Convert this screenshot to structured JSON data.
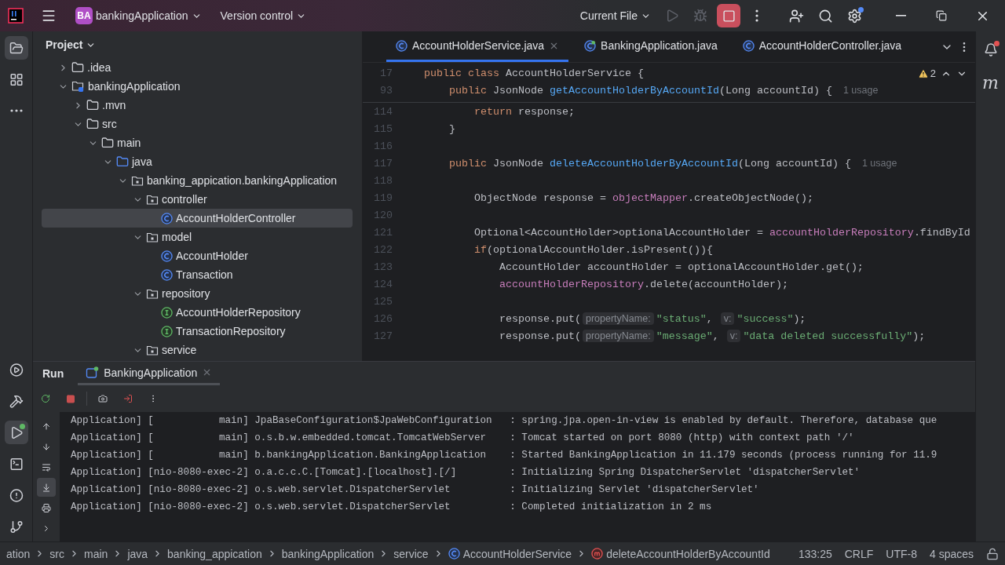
{
  "title_bar": {
    "project_badge": "BA",
    "project_name": "bankingApplication",
    "vcs_widget": "Version control",
    "run_config": "Current File",
    "run_enabled": false,
    "debug_enabled": false,
    "stop_enabled": true,
    "settings_update": true
  },
  "left_stripe": {
    "top": [
      {
        "kind": "project",
        "selected": true
      },
      {
        "kind": "structure",
        "selected": false
      },
      {
        "kind": "more",
        "selected": false
      }
    ],
    "bottom": [
      {
        "kind": "services",
        "selected": false,
        "running": false
      },
      {
        "kind": "build",
        "selected": false,
        "running": false
      },
      {
        "kind": "run",
        "selected": true,
        "running": true
      },
      {
        "kind": "terminal",
        "selected": false,
        "running": false
      },
      {
        "kind": "problems",
        "selected": false,
        "running": false
      },
      {
        "kind": "git",
        "selected": false,
        "running": false
      }
    ]
  },
  "project": {
    "title": "Project",
    "tree": [
      {
        "label": ".idea",
        "kind": "folder",
        "expanded": false,
        "selected": false
      },
      {
        "label": "bankingApplication",
        "kind": "module",
        "expanded": true,
        "selected": false,
        "children": [
          {
            "label": ".mvn",
            "kind": "folder",
            "expanded": false,
            "selected": false
          },
          {
            "label": "src",
            "kind": "folder",
            "expanded": true,
            "selected": false,
            "children": [
              {
                "label": "main",
                "kind": "folder",
                "expanded": true,
                "selected": false,
                "children": [
                  {
                    "label": "java",
                    "kind": "source",
                    "expanded": true,
                    "selected": false,
                    "children": [
                      {
                        "label": "banking_appication.bankingApplication",
                        "kind": "package",
                        "expanded": true,
                        "selected": false,
                        "children": [
                          {
                            "label": "controller",
                            "kind": "package",
                            "expanded": true,
                            "selected": false,
                            "children": [
                              {
                                "label": "AccountHolderController",
                                "kind": "class",
                                "selected": true
                              }
                            ]
                          },
                          {
                            "label": "model",
                            "kind": "package",
                            "expanded": true,
                            "selected": false,
                            "children": [
                              {
                                "label": "AccountHolder",
                                "kind": "class",
                                "selected": false
                              },
                              {
                                "label": "Transaction",
                                "kind": "class",
                                "selected": false
                              }
                            ]
                          },
                          {
                            "label": "repository",
                            "kind": "package",
                            "expanded": true,
                            "selected": false,
                            "children": [
                              {
                                "label": "AccountHolderRepository",
                                "kind": "interface",
                                "selected": false
                              },
                              {
                                "label": "TransactionRepository",
                                "kind": "interface",
                                "selected": false
                              }
                            ]
                          },
                          {
                            "label": "service",
                            "kind": "package",
                            "expanded": true,
                            "selected": false
                          }
                        ]
                      }
                    ]
                  }
                ]
              }
            ]
          }
        ]
      }
    ]
  },
  "editor": {
    "tabs": [
      {
        "label": "AccountHolderService.java",
        "kind": "class",
        "selected": true
      },
      {
        "label": "BankingApplication.java",
        "kind": "app",
        "selected": false
      },
      {
        "label": "AccountHolderController.java",
        "kind": "class",
        "selected": false
      }
    ],
    "warnings": "2",
    "sticky_lines": [
      {
        "number": "17",
        "segments": [
          {
            "kind": "kw",
            "text": "public class"
          },
          {
            "kind": "text",
            "text": " AccountHolderService {"
          }
        ]
      },
      {
        "number": "93",
        "segments": [
          {
            "kind": "kw",
            "text": "    public"
          },
          {
            "kind": "text",
            "text": " JsonNode "
          },
          {
            "kind": "decl",
            "text": "getAccountHolderByAccountId"
          },
          {
            "kind": "text",
            "text": "(Long accountId) { "
          },
          {
            "kind": "usage",
            "text": "1 usage"
          }
        ]
      }
    ],
    "lines": [
      {
        "number": "114",
        "segments": [
          {
            "kind": "kw",
            "text": "        return"
          },
          {
            "kind": "text",
            "text": " response;"
          }
        ]
      },
      {
        "number": "115",
        "segments": [
          {
            "kind": "text",
            "text": "    }"
          }
        ]
      },
      {
        "number": "116"
      },
      {
        "number": "117",
        "segments": [
          {
            "kind": "kw",
            "text": "    public"
          },
          {
            "kind": "text",
            "text": " JsonNode "
          },
          {
            "kind": "decl",
            "text": "deleteAccountHolderByAccountId"
          },
          {
            "kind": "text",
            "text": "(Long accountId) { "
          },
          {
            "kind": "usage",
            "text": "1 usage"
          }
        ]
      },
      {
        "number": "118"
      },
      {
        "number": "119",
        "segments": [
          {
            "kind": "text",
            "text": "        ObjectNode response = "
          },
          {
            "kind": "field",
            "text": "objectMapper"
          },
          {
            "kind": "text",
            "text": ".createObjectNode();"
          }
        ]
      },
      {
        "number": "120"
      },
      {
        "number": "121",
        "segments": [
          {
            "kind": "text",
            "text": "        Optional<AccountHolder>optionalAccountHolder = "
          },
          {
            "kind": "field",
            "text": "accountHolderRepository"
          },
          {
            "kind": "text",
            "text": ".findById"
          }
        ]
      },
      {
        "number": "122",
        "segments": [
          {
            "kind": "kw",
            "text": "        if"
          },
          {
            "kind": "text",
            "text": "(optionalAccountHolder.isPresent()){"
          }
        ]
      },
      {
        "number": "123",
        "segments": [
          {
            "kind": "text",
            "text": "            AccountHolder accountHolder = optionalAccountHolder.get();"
          }
        ]
      },
      {
        "number": "124",
        "segments": [
          {
            "kind": "field",
            "text": "            accountHolderRepository"
          },
          {
            "kind": "text",
            "text": ".delete(accountHolder);"
          }
        ]
      },
      {
        "number": "125"
      },
      {
        "number": "126",
        "segments": [
          {
            "kind": "text",
            "text": "            response.put("
          },
          {
            "kind": "hint",
            "text": "propertyName:"
          },
          {
            "kind": "str",
            "text": "\"status\""
          },
          {
            "kind": "text",
            "text": ", "
          },
          {
            "kind": "hint",
            "text": "v:"
          },
          {
            "kind": "str",
            "text": "\"success\""
          },
          {
            "kind": "text",
            "text": ");"
          }
        ]
      },
      {
        "number": "127",
        "segments": [
          {
            "kind": "text",
            "text": "            response.put("
          },
          {
            "kind": "hint",
            "text": "propertyName:"
          },
          {
            "kind": "str",
            "text": "\"message\""
          },
          {
            "kind": "text",
            "text": ", "
          },
          {
            "kind": "hint",
            "text": "v:"
          },
          {
            "kind": "str",
            "text": "\"data deleted successfully\""
          },
          {
            "kind": "text",
            "text": ");"
          }
        ]
      }
    ]
  },
  "right_stripe": {
    "notifications_unread": true,
    "maven_glyph": "m"
  },
  "run_panel": {
    "title": "Run",
    "tabs": [
      {
        "label": "BankingApplication",
        "selected": true,
        "running": true
      }
    ],
    "toolbar": [
      {
        "kind": "rerun"
      },
      {
        "kind": "stop"
      },
      {
        "kind": "screenshot"
      },
      {
        "kind": "exit"
      },
      {
        "kind": "more"
      }
    ],
    "side_tools": [
      {
        "kind": "up",
        "selected": false
      },
      {
        "kind": "down",
        "selected": false
      },
      {
        "kind": "wrap",
        "selected": false
      },
      {
        "kind": "scroll-end",
        "selected": true
      },
      {
        "kind": "print",
        "selected": false
      },
      {
        "kind": "expand",
        "selected": false
      }
    ],
    "log": [
      {
        "prefix": "Application] [           main]",
        "logger": "JpaBaseConfiguration$JpaWebConfiguration",
        "message": ": spring.jpa.open-in-view is enabled by default. Therefore, database que"
      },
      {
        "prefix": "Application] [           main]",
        "logger": "o.s.b.w.embedded.tomcat.TomcatWebServer",
        "message": ": Tomcat started on port 8080 (http) with context path '/'"
      },
      {
        "prefix": "Application] [           main]",
        "logger": "b.bankingApplication.BankingApplication",
        "message": ": Started BankingApplication in 11.179 seconds (process running for 11.9"
      },
      {
        "prefix": "Application] [nio-8080-exec-2]",
        "logger": "o.a.c.c.C.[Tomcat].[localhost].[/]",
        "message": ": Initializing Spring DispatcherServlet 'dispatcherServlet'"
      },
      {
        "prefix": "Application] [nio-8080-exec-2]",
        "logger": "o.s.web.servlet.DispatcherServlet",
        "message": ": Initializing Servlet 'dispatcherServlet'"
      },
      {
        "prefix": "Application] [nio-8080-exec-2]",
        "logger": "o.s.web.servlet.DispatcherServlet",
        "message": ": Completed initialization in 2 ms"
      }
    ]
  },
  "status_bar": {
    "breadcrumbs": [
      {
        "label": "ation",
        "kind": "path"
      },
      {
        "label": "src",
        "kind": "path"
      },
      {
        "label": "main",
        "kind": "path"
      },
      {
        "label": "java",
        "kind": "path"
      },
      {
        "label": "banking_appication",
        "kind": "path"
      },
      {
        "label": "bankingApplication",
        "kind": "path"
      },
      {
        "label": "service",
        "kind": "path"
      },
      {
        "label": "AccountHolderService",
        "kind": "class"
      },
      {
        "label": "deleteAccountHolderByAccountId",
        "kind": "method"
      }
    ],
    "position": "133:25",
    "line_separator": "CRLF",
    "encoding": "UTF-8",
    "indent": "4 spaces"
  }
}
